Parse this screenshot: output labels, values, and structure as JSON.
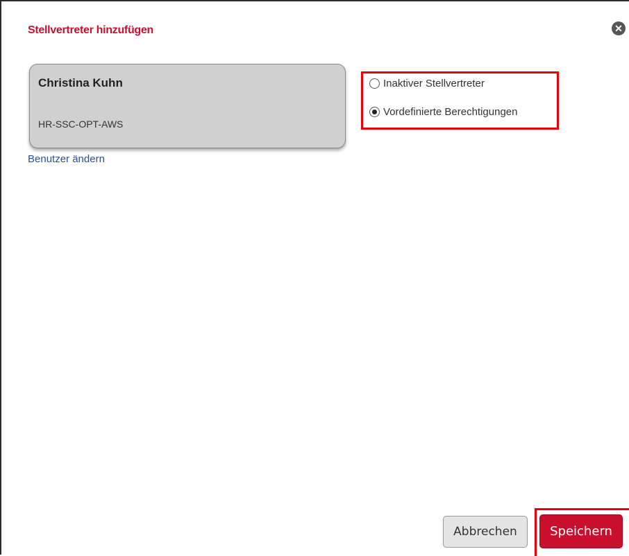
{
  "dialog": {
    "title": "Stellvertreter hinzufügen",
    "close_icon": "close-icon"
  },
  "user": {
    "name": "Christina Kuhn",
    "group": "HR-SSC-OPT-AWS",
    "change_link": "Benutzer ändern"
  },
  "options": [
    {
      "label": "Inaktiver Stellvertreter",
      "checked": false
    },
    {
      "label": "Vordefinierte Berechtigungen",
      "checked": true
    }
  ],
  "buttons": {
    "cancel": "Abbrechen",
    "save": "Speichern"
  },
  "colors": {
    "accent": "#c8102e",
    "highlight": "#e8000b",
    "link": "#2a4f9c"
  }
}
